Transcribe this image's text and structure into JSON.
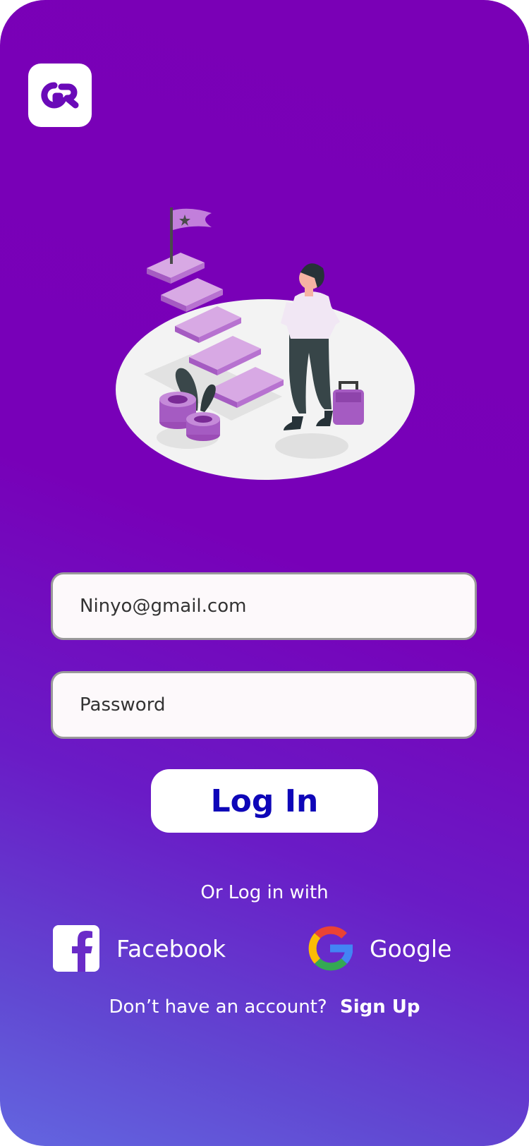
{
  "login": {
    "email_value": "Ninyo@gmail.com",
    "password_placeholder": "Password",
    "login_button": "Log In",
    "alt_login_text": "Or Log in with",
    "social": {
      "facebook_label": "Facebook",
      "google_label": "Google"
    },
    "signup_prompt": "Don’t have an account?",
    "signup_link": "Sign Up"
  },
  "icons": {
    "app_logo": "app-logo-icon",
    "facebook": "facebook-icon",
    "google": "google-icon",
    "illustration": "goal-stairs-illustration"
  },
  "colors": {
    "background_top": "#7800b8",
    "background_bottom": "#6366e0",
    "login_text": "#0e06b8",
    "logo": "#6a0ab8"
  }
}
